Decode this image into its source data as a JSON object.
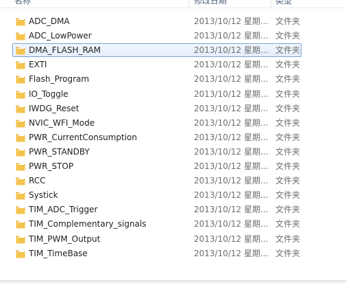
{
  "header": {
    "name_label": "名称",
    "date_label": "修改日期",
    "type_label": "类型"
  },
  "colors": {
    "folder_body": "#f4c44e",
    "folder_tab": "#e8ad2f",
    "selection_border": "#7da2ce"
  },
  "icon": "folder-icon",
  "files": [
    {
      "name": "ADC_DMA",
      "date": "2013/10/12 星期...",
      "type": "文件夹",
      "selected": false
    },
    {
      "name": "ADC_LowPower",
      "date": "2013/10/12 星期...",
      "type": "文件夹",
      "selected": false
    },
    {
      "name": "DMA_FLASH_RAM",
      "date": "2013/10/12 星期...",
      "type": "文件夹",
      "selected": true
    },
    {
      "name": "EXTI",
      "date": "2013/10/12 星期...",
      "type": "文件夹",
      "selected": false
    },
    {
      "name": "Flash_Program",
      "date": "2013/10/12 星期...",
      "type": "文件夹",
      "selected": false
    },
    {
      "name": "IO_Toggle",
      "date": "2013/10/12 星期...",
      "type": "文件夹",
      "selected": false
    },
    {
      "name": "IWDG_Reset",
      "date": "2013/10/12 星期...",
      "type": "文件夹",
      "selected": false
    },
    {
      "name": "NVIC_WFI_Mode",
      "date": "2013/10/12 星期...",
      "type": "文件夹",
      "selected": false
    },
    {
      "name": "PWR_CurrentConsumption",
      "date": "2013/10/12 星期...",
      "type": "文件夹",
      "selected": false
    },
    {
      "name": "PWR_STANDBY",
      "date": "2013/10/12 星期...",
      "type": "文件夹",
      "selected": false
    },
    {
      "name": "PWR_STOP",
      "date": "2013/10/12 星期...",
      "type": "文件夹",
      "selected": false
    },
    {
      "name": "RCC",
      "date": "2013/10/12 星期...",
      "type": "文件夹",
      "selected": false
    },
    {
      "name": "Systick",
      "date": "2013/10/12 星期...",
      "type": "文件夹",
      "selected": false
    },
    {
      "name": "TIM_ADC_Trigger",
      "date": "2013/10/12 星期...",
      "type": "文件夹",
      "selected": false
    },
    {
      "name": "TIM_Complementary_signals",
      "date": "2013/10/12 星期...",
      "type": "文件夹",
      "selected": false
    },
    {
      "name": "TIM_PWM_Output",
      "date": "2013/10/12 星期...",
      "type": "文件夹",
      "selected": false
    },
    {
      "name": "TIM_TimeBase",
      "date": "2013/10/12 星期...",
      "type": "文件夹",
      "selected": false
    }
  ]
}
